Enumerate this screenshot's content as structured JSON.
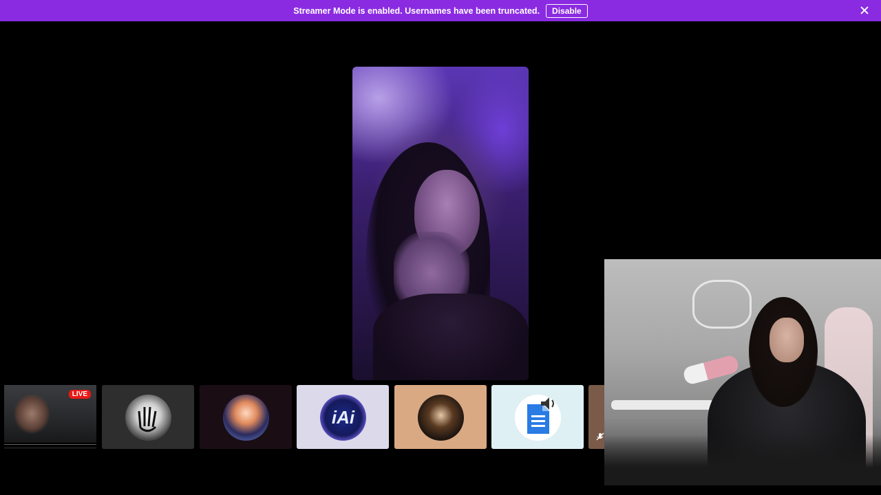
{
  "banner": {
    "message": "Streamer Mode is enabled. Usernames have been truncated.",
    "disable_label": "Disable",
    "bg_color": "#8a2be2"
  },
  "stream_tile": {
    "live_label": "LIVE"
  },
  "participants": [
    {
      "icon": "hand-avatar-icon",
      "bg": "#2e2e2e"
    },
    {
      "icon": "anime-character-avatar-icon",
      "bg": "#1a0e14"
    },
    {
      "icon": "iai-logo-avatar-icon",
      "bg": "#dcd9ea",
      "label": "iAi"
    },
    {
      "icon": "anime-warrior-avatar-icon",
      "bg": "#d9a984"
    },
    {
      "icon": "document-audio-avatar-icon",
      "bg": "#dff0f4"
    }
  ],
  "icons": {
    "close": "close-icon",
    "muted": "microphone-muted-icon"
  }
}
